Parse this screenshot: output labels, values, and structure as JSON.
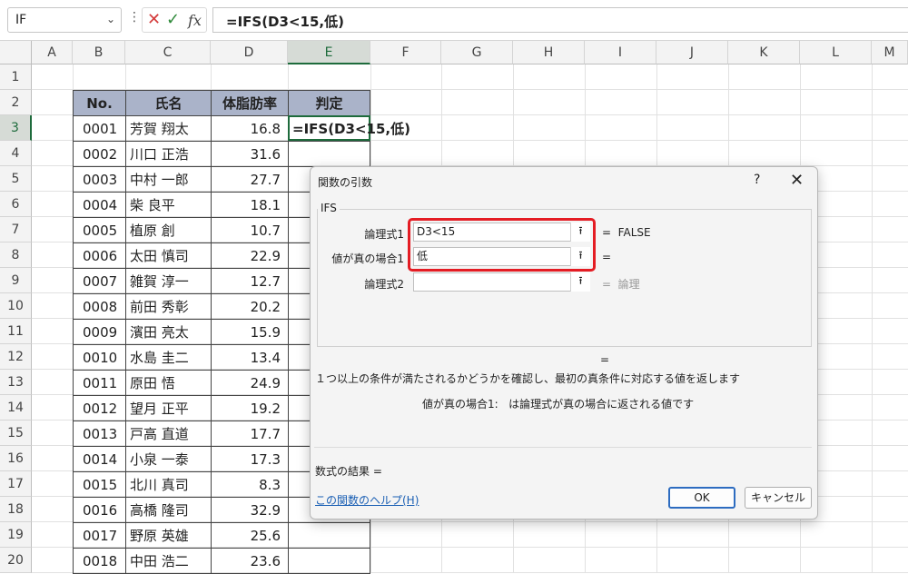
{
  "formula_bar": {
    "name_box": "IF",
    "name_box_dropdown_icon": "chevron-down-icon",
    "more_icon": "vertical-dots-icon",
    "cancel_icon": "close-icon",
    "enter_icon": "check-icon",
    "fx_label": "fx",
    "formula": "=IFS(D3<15,低)"
  },
  "columns": [
    "A",
    "B",
    "C",
    "D",
    "E",
    "F",
    "G",
    "H",
    "I",
    "J",
    "K",
    "L",
    "M"
  ],
  "rows": [
    "1",
    "2",
    "3",
    "4",
    "5",
    "6",
    "7",
    "8",
    "9",
    "10",
    "11",
    "12",
    "13",
    "14",
    "15",
    "16",
    "17",
    "18",
    "19",
    "20"
  ],
  "table": {
    "headers": [
      "No.",
      "氏名",
      "体脂肪率",
      "判定"
    ],
    "rows": [
      [
        "0001",
        "芳賀 翔太",
        "16.8"
      ],
      [
        "0002",
        "川口 正浩",
        "31.6"
      ],
      [
        "0003",
        "中村 一郎",
        "27.7"
      ],
      [
        "0004",
        "柴 良平",
        "18.1"
      ],
      [
        "0005",
        "植原 創",
        "10.7"
      ],
      [
        "0006",
        "太田 慎司",
        "22.9"
      ],
      [
        "0007",
        "雑賀 淳一",
        "12.7"
      ],
      [
        "0008",
        "前田 秀彰",
        "20.2"
      ],
      [
        "0009",
        "濱田 亮太",
        "15.9"
      ],
      [
        "0010",
        "水島 圭二",
        "13.4"
      ],
      [
        "0011",
        "原田 悟",
        "24.9"
      ],
      [
        "0012",
        "望月 正平",
        "19.2"
      ],
      [
        "0013",
        "戸高 直道",
        "17.7"
      ],
      [
        "0014",
        "小泉 一泰",
        "17.3"
      ],
      [
        "0015",
        "北川 真司",
        "8.3"
      ],
      [
        "0016",
        "高橋 隆司",
        "32.9"
      ],
      [
        "0017",
        "野原 英雄",
        "25.6"
      ],
      [
        "0018",
        "中田 浩二",
        "23.6"
      ]
    ],
    "active_cell_content": "=IFS(D3<15,低)"
  },
  "dialog": {
    "title": "関数の引数",
    "help_button": "?",
    "close_icon": "close-icon",
    "function_name": "IFS",
    "args": [
      {
        "label": "論理式1",
        "value": "D3<15",
        "result": "=  FALSE"
      },
      {
        "label": "値が真の場合1",
        "value": "低",
        "result": "="
      },
      {
        "label": "論理式2",
        "value": "",
        "result": "=  論理"
      }
    ],
    "collapse_icon": "collapse-arrow-icon",
    "collapse_glyph": "⭱",
    "overall_equals": "=",
    "description": "１つ以上の条件が満たされるかどうかを確認し、最初の真条件に対応する値を返します",
    "arg_help": "値が真の場合1:   は論理式が真の場合に返される値です",
    "formula_result_label": "数式の結果 =",
    "help_link": "この関数のヘルプ(H)",
    "ok_label": "OK",
    "cancel_label": "キャンセル",
    "highlight_color": "#e41c23"
  },
  "colors": {
    "table_header_bg": "#aab3c9",
    "selection_green": "#1e6b3c"
  }
}
